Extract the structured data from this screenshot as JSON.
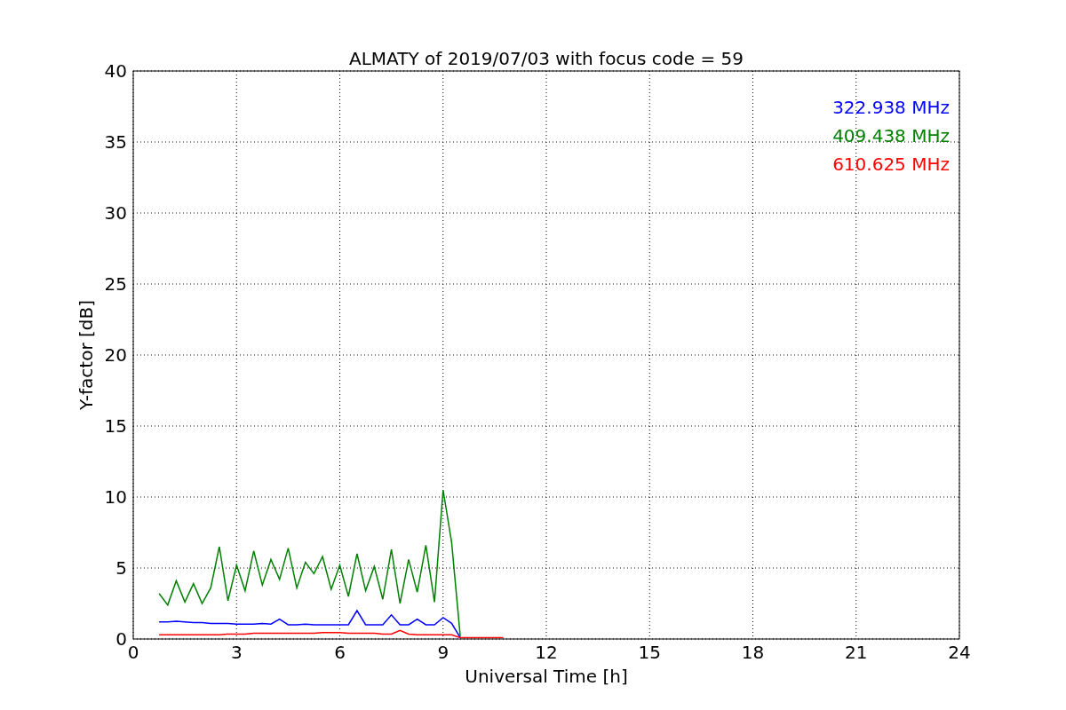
{
  "figure": {
    "chart_data": {
      "type": "line",
      "title": "ALMATY of 2019/07/03 with focus code = 59",
      "xlabel": "Universal Time [h]",
      "ylabel": "Y-factor [dB]",
      "x": [
        0.75,
        1.0,
        1.25,
        1.5,
        1.75,
        2.0,
        2.25,
        2.5,
        2.75,
        3.0,
        3.25,
        3.5,
        3.75,
        4.0,
        4.25,
        4.5,
        4.75,
        5.0,
        5.25,
        5.5,
        5.75,
        6.0,
        6.25,
        6.5,
        6.75,
        7.0,
        7.25,
        7.5,
        7.75,
        8.0,
        8.25,
        8.5,
        8.75,
        9.0,
        9.25,
        9.5,
        9.75,
        10.0,
        10.25,
        10.5,
        10.75
      ],
      "series": [
        {
          "name": "322.938 MHz",
          "color": "#0000ff",
          "values": [
            1.2,
            1.2,
            1.25,
            1.2,
            1.15,
            1.15,
            1.1,
            1.1,
            1.1,
            1.05,
            1.05,
            1.05,
            1.1,
            1.05,
            1.4,
            1.0,
            1.0,
            1.05,
            1.0,
            1.0,
            1.0,
            1.0,
            1.0,
            2.0,
            1.0,
            1.0,
            1.0,
            1.7,
            1.0,
            1.0,
            1.4,
            1.0,
            1.0,
            1.5,
            1.1,
            0.1,
            null,
            null,
            null,
            null,
            null
          ]
        },
        {
          "name": "409.438 MHz",
          "color": "#008000",
          "values": [
            3.2,
            2.4,
            4.1,
            2.6,
            3.9,
            2.5,
            3.6,
            6.5,
            2.7,
            5.2,
            3.4,
            6.2,
            3.8,
            5.6,
            4.2,
            6.4,
            3.6,
            5.4,
            4.6,
            5.8,
            3.5,
            5.2,
            3.0,
            6.0,
            3.4,
            5.1,
            2.8,
            6.3,
            2.5,
            5.6,
            3.3,
            6.6,
            2.6,
            10.5,
            6.8,
            0.2,
            null,
            null,
            null,
            null,
            null
          ]
        },
        {
          "name": "610.625 MHz",
          "color": "#ff0000",
          "values": [
            0.3,
            0.3,
            0.3,
            0.3,
            0.3,
            0.3,
            0.3,
            0.3,
            0.35,
            0.35,
            0.35,
            0.4,
            0.4,
            0.4,
            0.4,
            0.4,
            0.4,
            0.4,
            0.4,
            0.45,
            0.45,
            0.45,
            0.4,
            0.4,
            0.4,
            0.4,
            0.35,
            0.35,
            0.6,
            0.35,
            0.3,
            0.3,
            0.3,
            0.3,
            0.3,
            0.1,
            0.1,
            0.1,
            0.1,
            0.1,
            0.1
          ]
        }
      ],
      "grid": true,
      "xlim": [
        0,
        24
      ],
      "ylim": [
        0,
        40
      ],
      "xticks": [
        0,
        3,
        6,
        9,
        12,
        15,
        18,
        21,
        24
      ],
      "yticks": [
        0,
        5,
        10,
        15,
        20,
        25,
        30,
        35,
        40
      ]
    }
  }
}
